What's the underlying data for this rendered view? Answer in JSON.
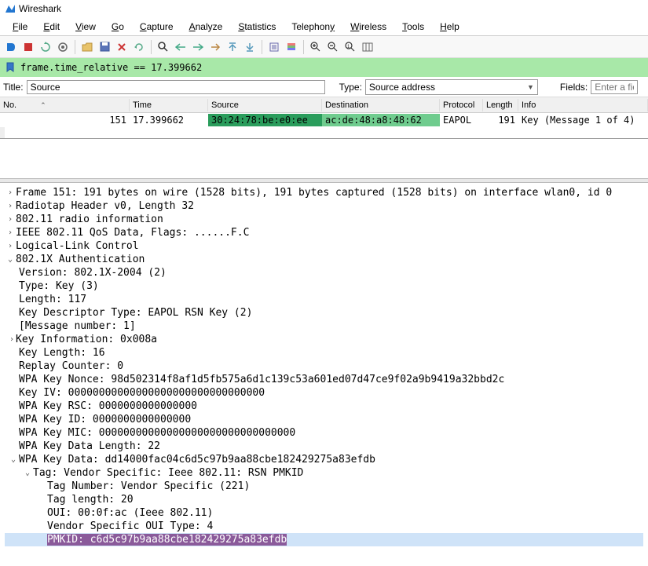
{
  "window": {
    "title": "Wireshark"
  },
  "menubar": {
    "file": "File",
    "edit": "Edit",
    "view": "View",
    "go": "Go",
    "capture": "Capture",
    "analyze": "Analyze",
    "statistics": "Statistics",
    "telephony": "Telephony",
    "wireless": "Wireless",
    "tools": "Tools",
    "help": "Help"
  },
  "filter": {
    "value": "frame.time_relative == 17.399662"
  },
  "fields_row": {
    "title_label": "Title:",
    "title_value": "Source",
    "type_label": "Type:",
    "type_value": "Source address",
    "fields_label": "Fields:",
    "fields_placeholder": "Enter a fiel"
  },
  "packet_list": {
    "headers": {
      "no": "No.",
      "time": "Time",
      "source": "Source",
      "destination": "Destination",
      "protocol": "Protocol",
      "length": "Length",
      "info": "Info"
    },
    "rows": [
      {
        "no": "151",
        "time": "17.399662",
        "source": "30:24:78:be:e0:ee",
        "destination": "ac:de:48:a8:48:62",
        "protocol": "EAPOL",
        "length": "191",
        "info": "Key (Message 1 of 4)"
      }
    ]
  },
  "details": {
    "frame": "Frame 151: 191 bytes on wire (1528 bits), 191 bytes captured (1528 bits) on interface wlan0, id 0",
    "radiotap": "Radiotap Header v0, Length 32",
    "radio_info": "802.11 radio information",
    "qos": "IEEE 802.11 QoS Data, Flags: ......F.C",
    "llc": "Logical-Link Control",
    "auth": "802.1X Authentication",
    "auth_version": "Version: 802.1X-2004 (2)",
    "auth_type": "Type: Key (3)",
    "auth_length": "Length: 117",
    "auth_kdt": "Key Descriptor Type: EAPOL RSN Key (2)",
    "auth_msgnum": "[Message number: 1]",
    "auth_keyinfo": "Key Information: 0x008a",
    "auth_keylen": "Key Length: 16",
    "auth_replay": "Replay Counter: 0",
    "auth_nonce": "WPA Key Nonce: 98d502314f8af1d5fb575a6d1c139c53a601ed07d47ce9f02a9b9419a32bbd2c",
    "auth_iv": "Key IV: 00000000000000000000000000000000",
    "auth_rsc": "WPA Key RSC: 0000000000000000",
    "auth_id": "WPA Key ID: 0000000000000000",
    "auth_mic": "WPA Key MIC: 00000000000000000000000000000000",
    "auth_datalen": "WPA Key Data Length: 22",
    "auth_keydata": "WPA Key Data: dd14000fac04c6d5c97b9aa88cbe182429275a83efdb",
    "tag_vs": "Tag: Vendor Specific: Ieee 802.11: RSN PMKID",
    "tag_num": "Tag Number: Vendor Specific (221)",
    "tag_len": "Tag length: 20",
    "tag_oui": "OUI: 00:0f:ac (Ieee 802.11)",
    "tag_ouitype": "Vendor Specific OUI Type: 4",
    "tag_pmkid": "PMKID: c6d5c97b9aa88cbe182429275a83efdb"
  },
  "icons": {
    "shark": "▟",
    "arrow_right": "►",
    "arrow_down": "▼"
  }
}
